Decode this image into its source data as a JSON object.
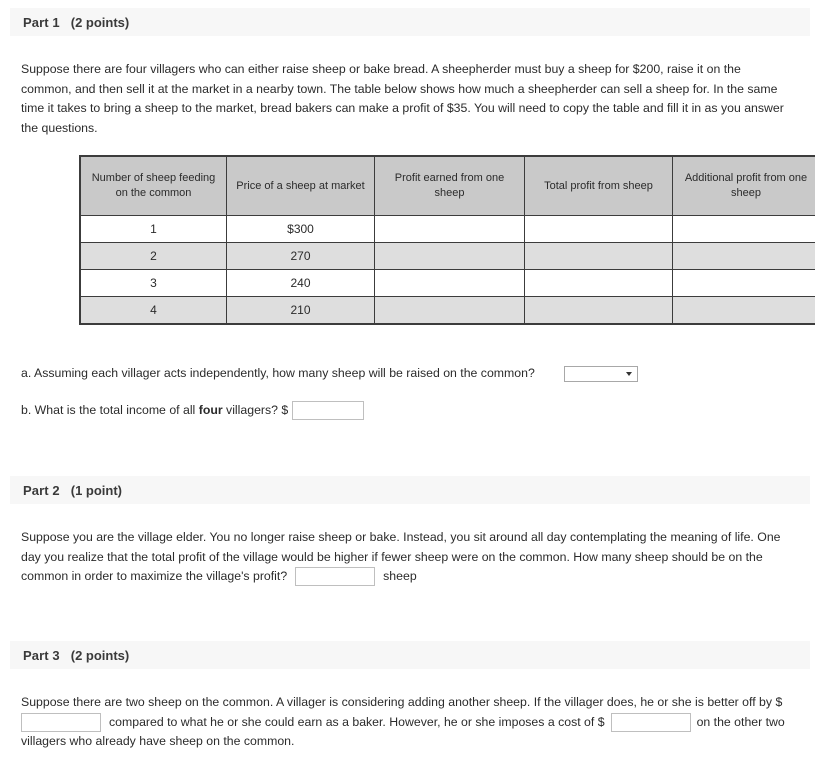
{
  "parts": [
    {
      "title": "Part 1",
      "points": "(2 points)",
      "body": "Suppose there are four villagers who can either raise sheep or bake bread. A sheepherder must buy a sheep for $200, raise it on the common, and then sell it at the market in a nearby town. The table below shows how much a sheepherder can sell a sheep for. In the same time it takes to bring a sheep to the market, bread bakers can make a profit of $35. You will need to copy the table and fill it in as you answer the questions."
    },
    {
      "title": "Part 2",
      "points": "(1 point)",
      "body_before": "Suppose you are the village elder. You no longer raise sheep or bake. Instead, you sit around all day contemplating the meaning of life. One day you realize that the total profit of the village would be higher if fewer sheep were on the common. How many sheep should be on the common in order to maximize the village's profit?",
      "body_after": "sheep",
      "input_value": "",
      "input_placeholder": ""
    },
    {
      "title": "Part 3",
      "points": "(2 points)",
      "segment_1": "Suppose there are two sheep on the common. A villager is considering adding another sheep. If the villager does, he or she is better off by $",
      "segment_2": "compared to what he or she could earn as a baker. However, he or she imposes a cost of $",
      "segment_3": "on the other two villagers who already have sheep on the common.",
      "input_1_value": "",
      "input_2_value": "",
      "input_placeholder": ""
    }
  ],
  "table": {
    "headers": [
      "Number of sheep feeding on the common",
      "Price of a sheep at market",
      "Profit earned from one sheep",
      "Total profit from sheep",
      "Additional profit from one sheep"
    ],
    "rows": [
      {
        "sheep": "1",
        "price": "$300",
        "profit_one": "",
        "total_profit": "",
        "additional_profit": ""
      },
      {
        "sheep": "2",
        "price": "270",
        "profit_one": "",
        "total_profit": "",
        "additional_profit": ""
      },
      {
        "sheep": "3",
        "price": "240",
        "profit_one": "",
        "total_profit": "",
        "additional_profit": ""
      },
      {
        "sheep": "4",
        "price": "210",
        "profit_one": "",
        "total_profit": "",
        "additional_profit": ""
      }
    ]
  },
  "questions": {
    "a_text": "a. Assuming each villager acts independently, how many sheep will be raised on the common?",
    "a_select_value": "",
    "b_text_before": "b. What is the total income of all ",
    "b_text_bold": "four",
    "b_text_after": " villagers? $",
    "b_input_value": "",
    "b_input_placeholder": ""
  },
  "colors": {
    "header_bar": "#f7f7f7",
    "table_header": "#c9c9c9",
    "table_alt_row": "#dedede",
    "table_border": "#3c3c3c",
    "input_border": "#bfbfbf",
    "text": "#2b2b2b"
  }
}
